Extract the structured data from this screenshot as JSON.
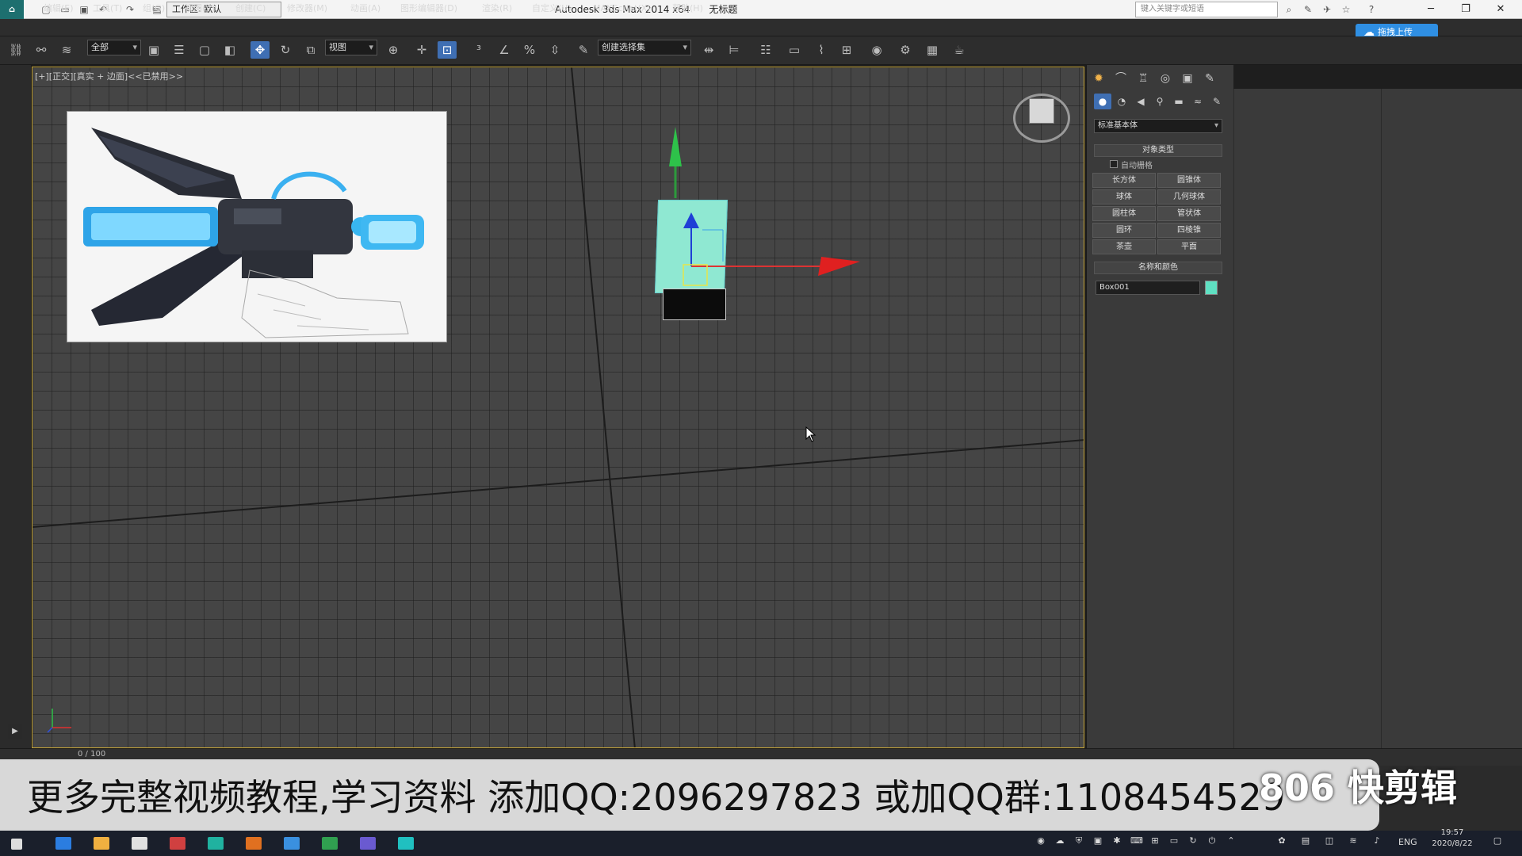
{
  "title_bar": {
    "workspace": "工作区: 默认",
    "app_title": "Autodesk 3ds Max  2014 x64",
    "doc_title": "无标题",
    "search_placeholder": "键入关键字或短语"
  },
  "menu": [
    "编辑(E)",
    "工具(T)",
    "组(G)",
    "视图(V)",
    "创建(C)",
    "修改器(M)",
    "动画(A)",
    "图形编辑器(D)",
    "渲染(R)",
    "自定义(U)",
    "MAXScript(X)",
    "帮助(H)"
  ],
  "cloud_button": "拖拽上传",
  "toolbar": {
    "selection_filter": "全部",
    "ref_coord": "视图",
    "named_selection": "创建选择集"
  },
  "viewport": {
    "label": "[+][正交][真实 + 边面]<<已禁用>>"
  },
  "command_panel": {
    "category": "标准基本体",
    "object_type_header": "对象类型",
    "autogrid_label": "自动栅格",
    "primitives": [
      "长方体",
      "圆锥体",
      "球体",
      "几何球体",
      "圆柱体",
      "管状体",
      "圆环",
      "四棱锥",
      "茶壶",
      "平面"
    ],
    "name_color_header": "名称和颜色",
    "object_name": "Box001",
    "object_color": "#5fe0c2"
  },
  "timeline": {
    "frame": "0 / 100"
  },
  "watermark": {
    "text": "更多完整视频教程,学习资料 添加QQ:2096297823 或加QQ群:1108454529",
    "brand": "806 快剪辑"
  },
  "taskbar": {
    "lang": "ENG",
    "time": "19:57",
    "date": "2020/8/22"
  }
}
